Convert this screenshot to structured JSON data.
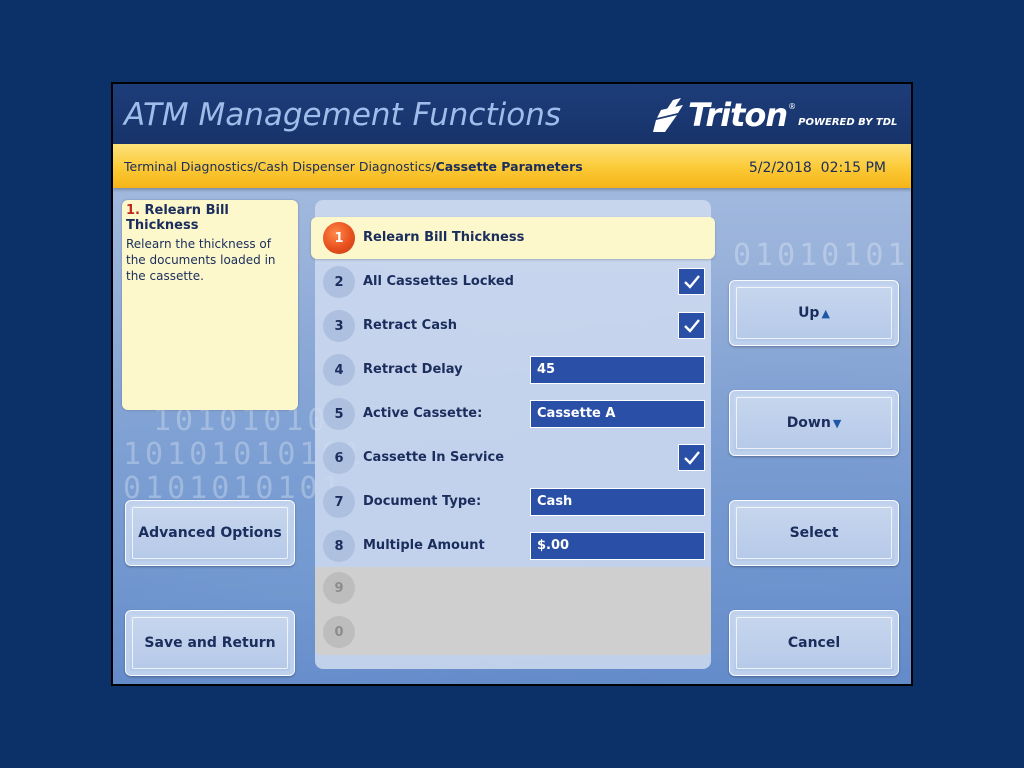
{
  "header": {
    "title": "ATM Management Functions",
    "logo_text": "Triton",
    "logo_reg": "®",
    "logo_powered": "POWERED BY TDL"
  },
  "breadcrumb": {
    "path": "Terminal Diagnostics/Cash Dispenser Diagnostics/",
    "current": "Cassette Parameters"
  },
  "datetime": "5/2/2018  02:15 PM",
  "help": {
    "number": "1.",
    "title": "Relearn Bill Thickness",
    "description": "Relearn the thickness of the documents loaded in the cassette."
  },
  "menu": {
    "items": [
      {
        "number": "1",
        "label": "Relearn Bill Thickness",
        "selected": true
      },
      {
        "number": "2",
        "label": "All Cassettes Locked",
        "checked": true
      },
      {
        "number": "3",
        "label": "Retract Cash",
        "checked": true
      },
      {
        "number": "4",
        "label": "Retract Delay",
        "value": "45"
      },
      {
        "number": "5",
        "label": "Active Cassette:",
        "value": "Cassette A"
      },
      {
        "number": "6",
        "label": "Cassette In Service",
        "checked": true
      },
      {
        "number": "7",
        "label": "Document Type:",
        "value": "Cash"
      },
      {
        "number": "8",
        "label": "Multiple Amount",
        "value": "$.00"
      },
      {
        "number": "9",
        "label": "",
        "disabled": true
      },
      {
        "number": "0",
        "label": "",
        "disabled": true
      }
    ]
  },
  "buttons": {
    "advanced_options": "Advanced Options",
    "save_and_return": "Save and Return",
    "up": "Up",
    "down": "Down",
    "select": "Select",
    "cancel": "Cancel",
    "up_arrow": "▲",
    "down_arrow": "▼"
  },
  "background": {
    "binary_lines": [
      "10101010",
      "10101010101",
      "0101010101",
      "0101010101"
    ]
  },
  "colors": {
    "page_background": "#0c3068",
    "title_bar": "#17336a",
    "breadcrumb_bar": "#fbc936",
    "field_fill": "#2a4fa6",
    "selected_badge": "#e8501e",
    "help_box": "#fdf8cc"
  }
}
